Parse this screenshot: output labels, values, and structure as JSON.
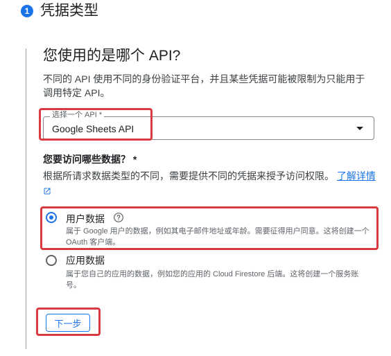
{
  "step": {
    "number": "1",
    "title": "凭据类型"
  },
  "question": {
    "title": "您使用的是哪个 API?",
    "description": "不同的 API 使用不同的身份验证平台，并且某些凭据可能被限制为只能用于调用特定 API。"
  },
  "api_select": {
    "label": "选择一个 API *",
    "value": "Google Sheets API"
  },
  "data_access": {
    "question": "您要访问哪些数据？ *",
    "description": "根据所请求数据类型的不同，需要提供不同的凭据来授予访问权限。",
    "learn_more": "了解详情"
  },
  "options": [
    {
      "label": "用户数据",
      "description": "属于 Google 用户的数据，例如其电子邮件地址或年龄。需要征得用户同意。这将创建一个 OAuth 客户端。",
      "selected": true
    },
    {
      "label": "应用数据",
      "description": "属于您自己的应用的数据，例如您的应用的 Cloud Firestore 后端。这将创建一个服务账号。",
      "selected": false
    }
  ],
  "next_button": {
    "label": "下一步"
  },
  "colors": {
    "accent": "#1a73e8",
    "highlight": "#d93a40"
  },
  "icons": {
    "help": "help-circle-icon",
    "external": "external-link-icon",
    "dropdown": "dropdown-arrow-icon"
  }
}
